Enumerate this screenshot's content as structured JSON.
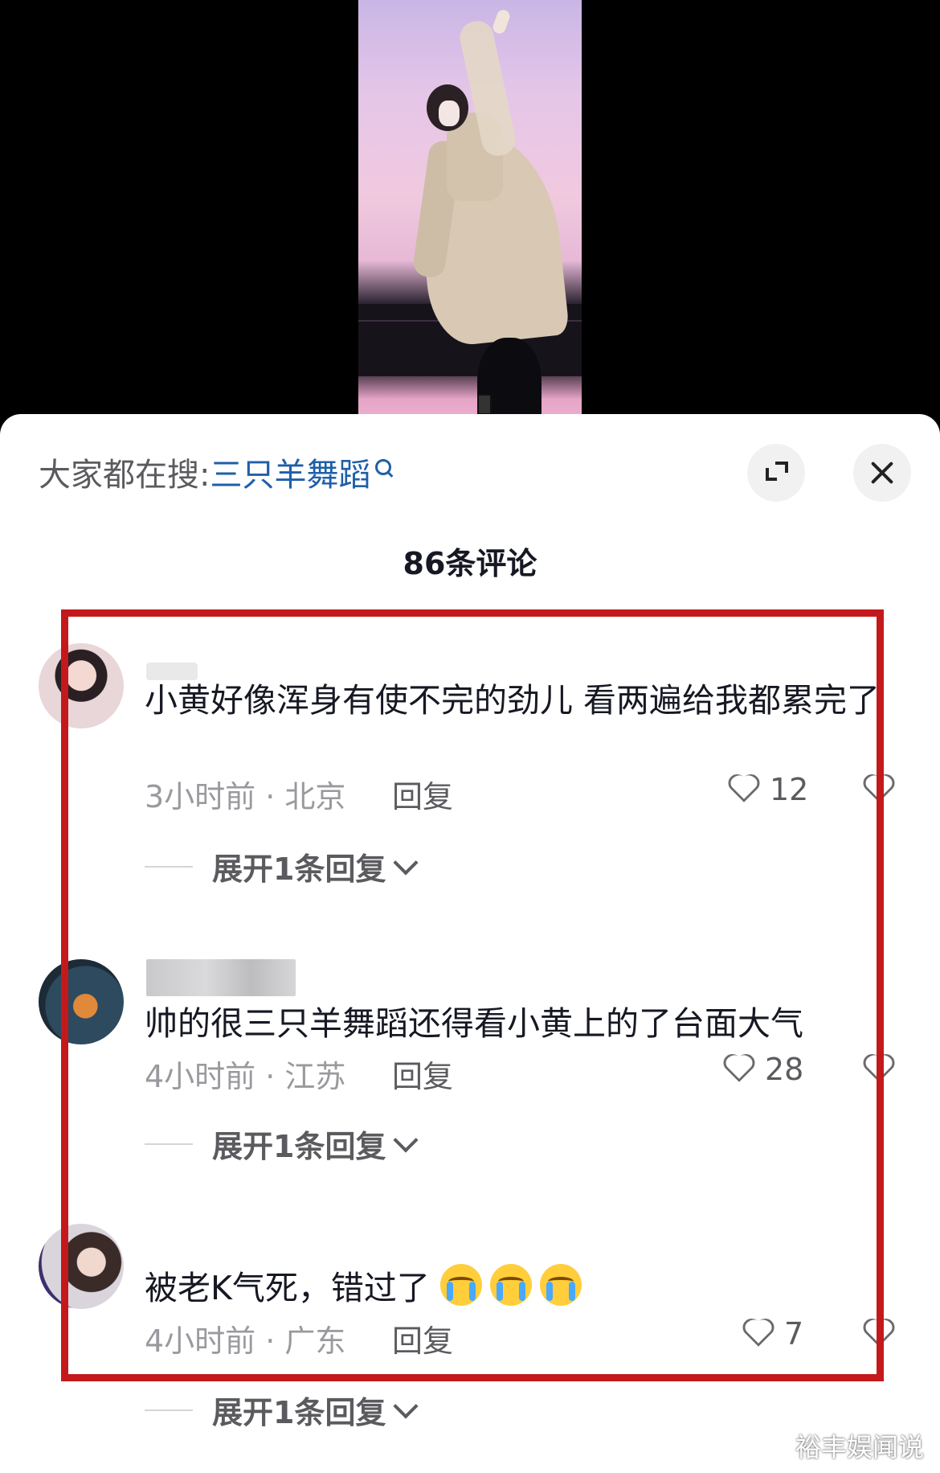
{
  "search": {
    "prefix": "大家都在搜:",
    "keyword": "三只羊舞蹈"
  },
  "header": {
    "comment_count": "86条评论"
  },
  "comments": [
    {
      "text": "小黄好像浑身有使不完的劲儿 看两遍给我都累完了",
      "time_location": "3小时前 · 北京",
      "reply_label": "回复",
      "likes": "12",
      "expand_label": "展开1条回复"
    },
    {
      "text": "帅的很三只羊舞蹈还得看小黄上的了台面大气",
      "time_location": "4小时前 · 江苏",
      "reply_label": "回复",
      "likes": "28",
      "expand_label": "展开1条回复"
    },
    {
      "text": "被老K气死，错过了",
      "emoji_count": 3,
      "time_location": "4小时前 · 广东",
      "reply_label": "回复",
      "likes": "7",
      "expand_label": "展开1条回复"
    }
  ],
  "colors": {
    "highlight": "#c4191c",
    "keyword": "#1f5fa8"
  },
  "watermark": "裕丰娱闻说"
}
